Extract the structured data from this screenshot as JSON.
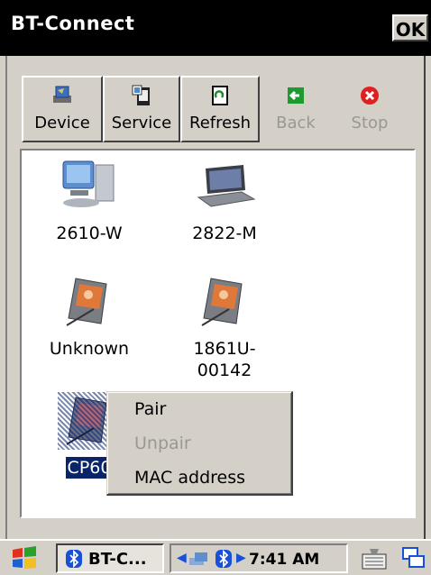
{
  "window": {
    "title": "BT-Connect",
    "ok_label": "OK"
  },
  "toolbar": {
    "buttons": [
      {
        "label": "Device",
        "icon": "device-icon",
        "enabled": true
      },
      {
        "label": "Service",
        "icon": "service-icon",
        "enabled": true
      },
      {
        "label": "Refresh",
        "icon": "refresh-icon",
        "enabled": true
      },
      {
        "label": "Back",
        "icon": "back-arrow-icon",
        "enabled": false
      },
      {
        "label": "Stop",
        "icon": "stop-icon",
        "enabled": false
      }
    ]
  },
  "devices": [
    {
      "label": "2610-W",
      "icon": "desktop-computer-icon"
    },
    {
      "label": "2822-M",
      "icon": "laptop-icon"
    },
    {
      "label": "Unknown",
      "icon": "pda-icon"
    },
    {
      "label": "1861U-\n00142",
      "icon": "pda-icon"
    },
    {
      "label": "CP60",
      "icon": "pda-icon",
      "selected": true
    }
  ],
  "context_menu": {
    "items": [
      {
        "label": "Pair",
        "enabled": true
      },
      {
        "label": "Unpair",
        "enabled": false
      },
      {
        "label": "MAC address",
        "enabled": true
      }
    ]
  },
  "taskbar": {
    "task_label": "BT-C...",
    "clock": "7:41 AM"
  },
  "colors": {
    "titlebar": "#000000",
    "selection": "#0a246a",
    "chrome": "#d4d0c8"
  }
}
